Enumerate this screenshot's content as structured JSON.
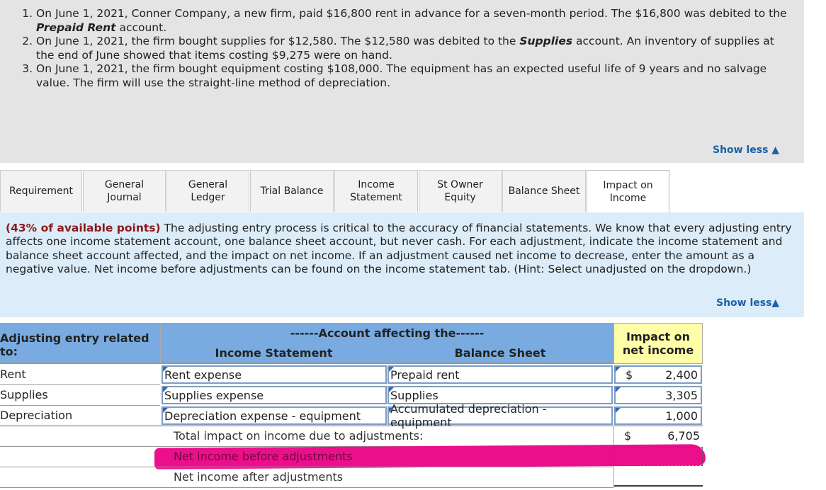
{
  "problem": {
    "items": [
      {
        "pre": "On June 1, 2021, Conner Company, a new firm, paid $16,800 rent in advance for a seven-month period. The $16,800 was debited to the ",
        "bold": "Prepaid Rent",
        "post": " account."
      },
      {
        "pre": "On June 1, 2021, the firm bought supplies for $12,580. The $12,580 was debited to the ",
        "bold": "Supplies",
        "post": " account. An inventory of supplies at the end of June showed that items costing $9,275 were on hand."
      },
      {
        "pre": "On June 1, 2021, the firm bought equipment costing $108,000. The equipment has an expected useful life of 9 years and no salvage value. The firm will use the straight-line method of depreciation.",
        "bold": "",
        "post": ""
      }
    ],
    "show_less": "Show less ▲"
  },
  "tabs": [
    {
      "label": "Requirement"
    },
    {
      "label": "General Journal"
    },
    {
      "label": "General Ledger"
    },
    {
      "label": "Trial Balance"
    },
    {
      "label": "Income Statement"
    },
    {
      "label": "St Owner Equity"
    },
    {
      "label": "Balance Sheet"
    },
    {
      "label": "Impact on Income",
      "active": true
    }
  ],
  "instructions": {
    "points": "(43% of available points)",
    "text": " The adjusting entry process is critical to the accuracy of financial statements.  We know that every adjusting entry affects one income statement account, one balance sheet account, but never cash.  For each adjustment, indicate the income statement and balance sheet account affected, and the impact on net income.  If an adjustment caused net income to decrease, enter the amount as a negative value.  Net income before adjustments can be found on the income statement tab.  (Hint: Select unadjusted on the dropdown.)",
    "show_less": "Show less▲"
  },
  "table": {
    "group_header": "------Account affecting the------",
    "col_entry": "Adjusting entry related to:",
    "col_is": "Income Statement",
    "col_bs": "Balance Sheet",
    "col_impact": "Impact on net income",
    "rows": [
      {
        "entry": "Rent",
        "is": "Rent expense",
        "bs": "Prepaid rent",
        "dollar": "$",
        "impact": "2,400"
      },
      {
        "entry": "Supplies",
        "is": "Supplies expense",
        "bs": "Supplies",
        "dollar": "",
        "impact": "3,305"
      },
      {
        "entry": "Depreciation",
        "is": "Depreciation expense - equipment",
        "bs": "Accumulated depreciation - equipment",
        "dollar": "",
        "impact": "1,000"
      }
    ],
    "total_label": "Total impact on income due to adjustments:",
    "total_dollar": "$",
    "total_value": "6,705",
    "before_label": "Net income before adjustments",
    "after_label": "Net income after adjustments"
  },
  "colors": {
    "header_blue": "#79abe0",
    "impact_yellow": "#ffffa8",
    "redaction_pink": "#ec0f8c"
  }
}
